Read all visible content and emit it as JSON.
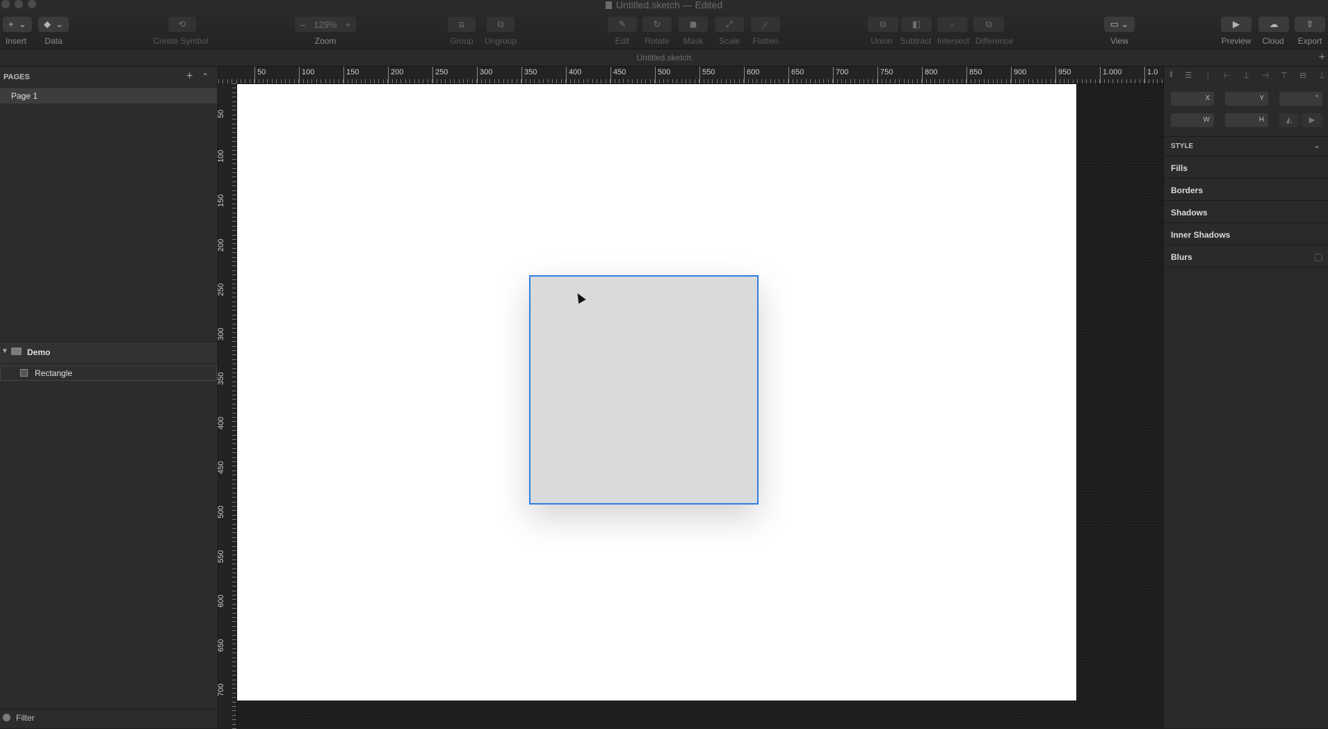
{
  "window": {
    "title": "Untitled.sketch — Edited",
    "doc_tab": "Untitled.sketch"
  },
  "toolbar": {
    "insert": "Insert",
    "data": "Data",
    "create_symbol": "Create Symbol",
    "zoom_value": "129%",
    "zoom_minus": "–",
    "zoom_plus": "+",
    "zoom": "Zoom",
    "group": "Group",
    "ungroup": "Ungroup",
    "edit": "Edit",
    "rotate": "Rotate",
    "mask": "Mask",
    "scale": "Scale",
    "flatten": "Flatten",
    "union": "Union",
    "subtract": "Subtract",
    "intersect": "Intersect",
    "difference": "Difference",
    "view": "View",
    "preview": "Preview",
    "cloud": "Cloud",
    "export": "Export"
  },
  "pages": {
    "header": "PAGES",
    "items": [
      "Page 1"
    ],
    "add": "+",
    "collapse": "^"
  },
  "layers": {
    "artboard": "Demo",
    "items": [
      "Rectangle"
    ]
  },
  "filter": {
    "label": "Filter"
  },
  "rulers": {
    "h": [
      "50",
      "100",
      "150",
      "200",
      "250",
      "300",
      "350",
      "400",
      "450",
      "500",
      "550",
      "600",
      "650",
      "700",
      "750",
      "800",
      "850",
      "900",
      "950",
      "1.000",
      "1.0"
    ],
    "v": [
      "50",
      "100",
      "150",
      "200",
      "250",
      "300",
      "350",
      "400",
      "450",
      "500",
      "550",
      "600",
      "650",
      "700"
    ]
  },
  "inspector": {
    "x": "X",
    "y": "Y",
    "rot": "°",
    "w": "W",
    "h": "H",
    "style": "STYLE",
    "fills": "Fills",
    "borders": "Borders",
    "shadows": "Shadows",
    "inner_shadows": "Inner Shadows",
    "blurs": "Blurs"
  },
  "colors": {
    "accent": "#2f7de1",
    "rect_fill": "#d9dadb"
  }
}
